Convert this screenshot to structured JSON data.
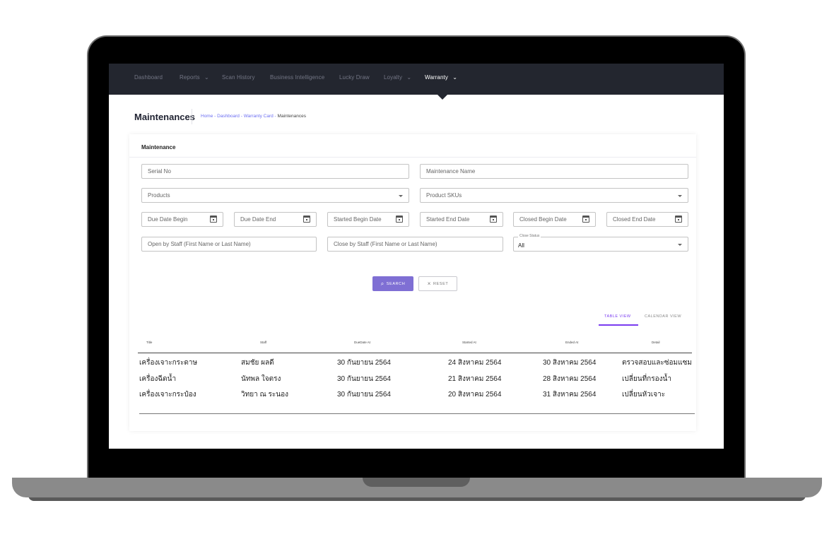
{
  "nav": {
    "items": [
      {
        "label": "Dashboard"
      },
      {
        "label": "Reports"
      },
      {
        "label": "Scan History"
      },
      {
        "label": "Business Intelligence"
      },
      {
        "label": "Lucky Draw"
      },
      {
        "label": "Loyalty"
      },
      {
        "label": "Warranty"
      }
    ],
    "dropdown_caret": "⌄",
    "active": "Warranty"
  },
  "page": {
    "title": "Maintenances",
    "breadcrumb": [
      "Home",
      "Dashboard",
      "Warranty Card",
      "Maintenances"
    ],
    "breadcrumb_separator": " - "
  },
  "card": {
    "title": "Maintenance"
  },
  "filters": {
    "serial_no": "Serial No",
    "maintenance_name": "Maintenance Name",
    "products": "Products",
    "product_skus": "Product SKUs",
    "due_date_begin": "Due Date Begin",
    "due_date_end": "Due Date End",
    "started_begin_date": "Started Begin Date",
    "started_end_date": "Started End Date",
    "closed_begin_date": "Closed Begin Date",
    "closed_end_date": "Closed End Date",
    "open_by_staff": "Open by Staff (First Name or Last Name)",
    "close_by_staff": "Close by Staff (First Name or Last Name)",
    "close_status_label": "Close Status",
    "close_status_value": "All"
  },
  "buttons": {
    "search": "SEARCH",
    "reset": "RESET",
    "search_icon": "⌕",
    "reset_icon": "×"
  },
  "views": {
    "table": "TABLE VIEW",
    "calendar": "CALENDAR VIEW",
    "active": "TABLE VIEW"
  },
  "table": {
    "headers": [
      "Title",
      "Staff",
      "DueDate At",
      "Started At",
      "Ended At",
      "Detail"
    ],
    "rows": [
      [
        "เครื่องเจาะกระดาษ",
        "สมชัย ผลดี",
        "30 กันยายน 2564",
        "24 สิงหาคม 2564",
        "30 สิงหาคม 2564",
        "ตรวจสอบและซ่อมแซม"
      ],
      [
        "เครื่องฉีดน้ำ",
        "นัทพล ใจตรง",
        "30 กันยายน 2564",
        "21 สิงหาคม 2564",
        "28 สิงหาคม 2564",
        "เปลี่ยนที่กรองน้ำ"
      ],
      [
        "เครื่องเจาะกระป๋อง",
        "วิทยา ณ ระนอง",
        "30 กันยายน 2564",
        "20 สิงหาคม 2564",
        "31 สิงหาคม 2564",
        "เปลี่ยนหัวเจาะ"
      ]
    ]
  },
  "colors": {
    "navbar": "#23262f",
    "accent": "#7f6fd4",
    "tab_active": "#7a3cf0",
    "link": "#6c6ff2"
  }
}
